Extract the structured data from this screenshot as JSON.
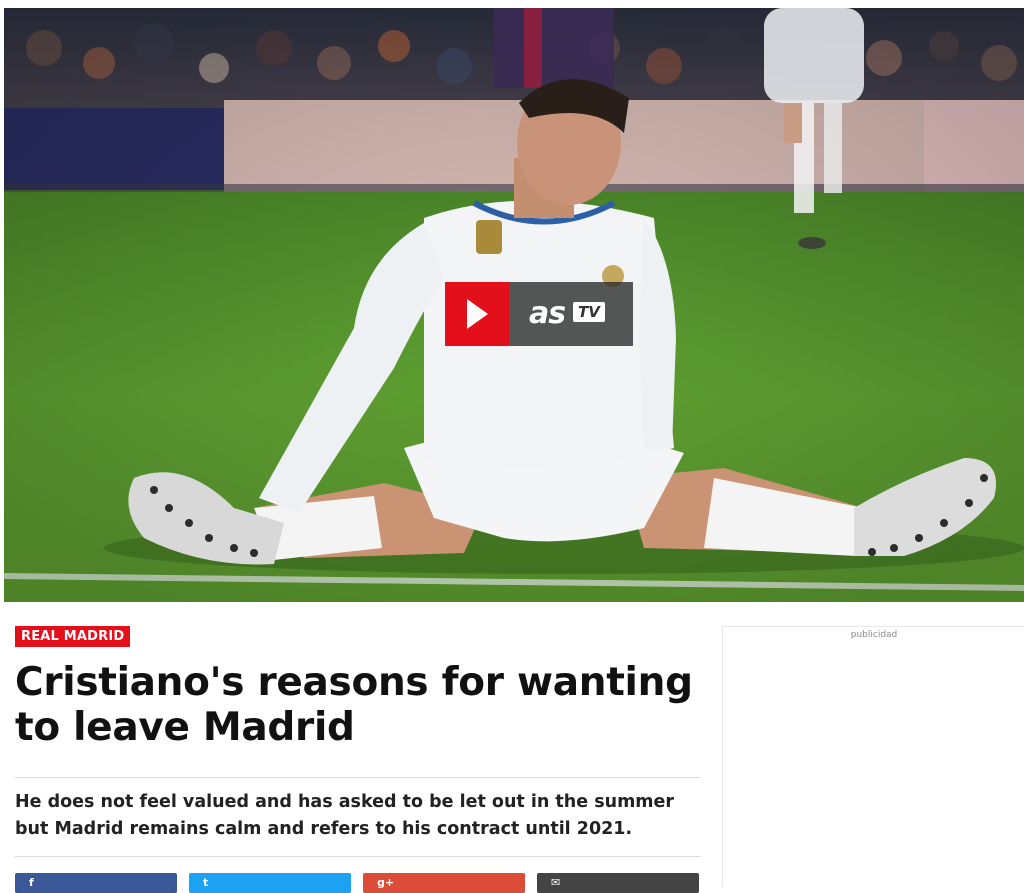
{
  "hero": {
    "video_brand": "as",
    "video_brand_tv": "TV",
    "play_icon": "play-icon"
  },
  "article": {
    "section_badge": "REAL MADRID",
    "headline": "Cristiano's reasons for wanting to leave Madrid",
    "subhead": "He does not feel valued and has asked to be let out in the summer but Madrid remains calm and refers to his contract until 2021."
  },
  "share": {
    "icons": [
      "facebook-icon",
      "twitter-icon",
      "google-plus-icon",
      "email-icon"
    ],
    "colors": [
      "#3b5998",
      "#1da1f2",
      "#dd4b39",
      "#444444"
    ]
  },
  "ad": {
    "label": "publicidad"
  },
  "colors": {
    "accent": "#e3101b",
    "pitch": "#5a9e2e"
  }
}
